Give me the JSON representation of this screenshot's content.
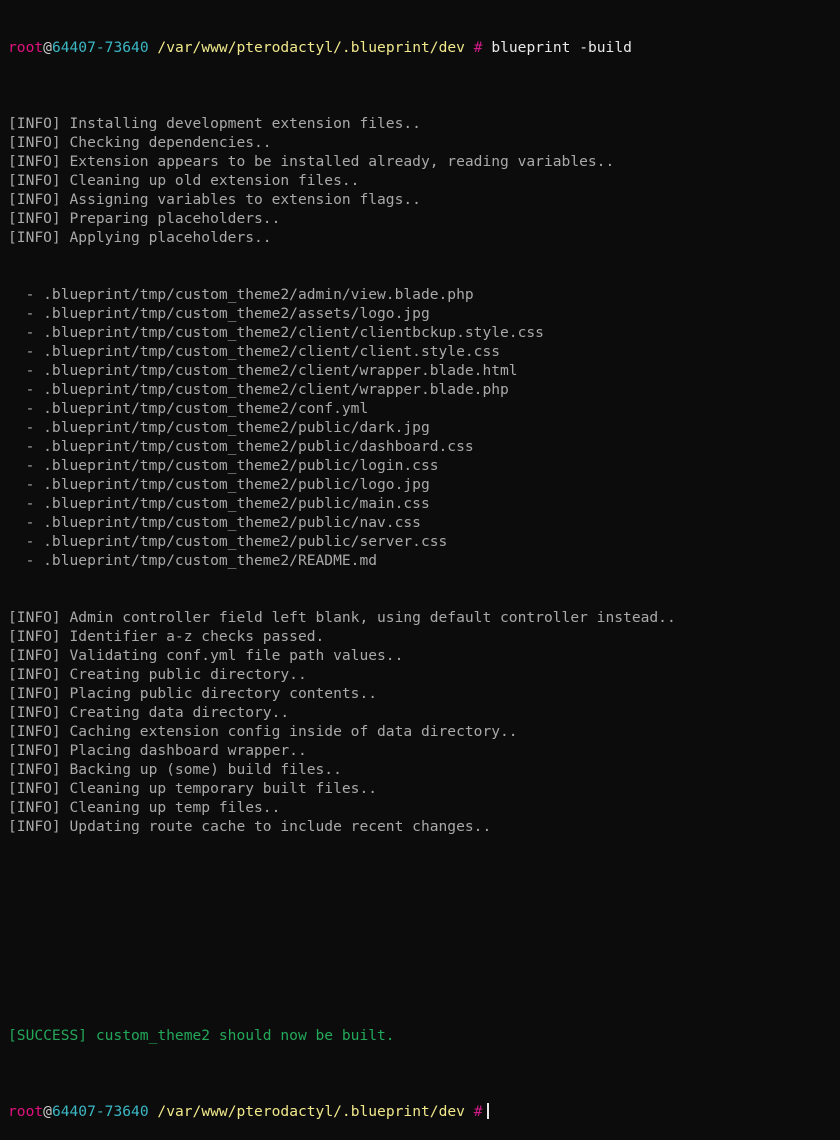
{
  "prompt": {
    "user": "root",
    "at": "@",
    "host": "64407-73640",
    "path": "/var/www/pterodactyl/.blueprint/dev",
    "symbol": "#"
  },
  "command": "blueprint -build",
  "lines_before_files": [
    "[INFO] Installing development extension files..",
    "[INFO] Checking dependencies..",
    "[INFO] Extension appears to be installed already, reading variables..",
    "[INFO] Cleaning up old extension files..",
    "[INFO] Assigning variables to extension flags..",
    "[INFO] Preparing placeholders..",
    "[INFO] Applying placeholders.."
  ],
  "files": [
    "  - .blueprint/tmp/custom_theme2/admin/view.blade.php",
    "  - .blueprint/tmp/custom_theme2/assets/logo.jpg",
    "  - .blueprint/tmp/custom_theme2/client/clientbckup.style.css",
    "  - .blueprint/tmp/custom_theme2/client/client.style.css",
    "  - .blueprint/tmp/custom_theme2/client/wrapper.blade.html",
    "  - .blueprint/tmp/custom_theme2/client/wrapper.blade.php",
    "  - .blueprint/tmp/custom_theme2/conf.yml",
    "  - .blueprint/tmp/custom_theme2/public/dark.jpg",
    "  - .blueprint/tmp/custom_theme2/public/dashboard.css",
    "  - .blueprint/tmp/custom_theme2/public/login.css",
    "  - .blueprint/tmp/custom_theme2/public/logo.jpg",
    "  - .blueprint/tmp/custom_theme2/public/main.css",
    "  - .blueprint/tmp/custom_theme2/public/nav.css",
    "  - .blueprint/tmp/custom_theme2/public/server.css",
    "  - .blueprint/tmp/custom_theme2/README.md"
  ],
  "lines_after_files": [
    "[INFO] Admin controller field left blank, using default controller instead..",
    "[INFO] Identifier a-z checks passed.",
    "[INFO] Validating conf.yml file path values..",
    "[INFO] Creating public directory..",
    "[INFO] Placing public directory contents..",
    "[INFO] Creating data directory..",
    "[INFO] Caching extension config inside of data directory..",
    "[INFO] Placing dashboard wrapper..",
    "[INFO] Backing up (some) build files..",
    "[INFO] Cleaning up temporary built files..",
    "[INFO] Cleaning up temp files..",
    "[INFO] Updating route cache to include recent changes.."
  ],
  "success": "[SUCCESS] custom_theme2 should now be built.",
  "colors": {
    "background": "#0c0c0c",
    "user": "#e0127f",
    "host": "#3cb7c4",
    "path": "#f0e88a",
    "text": "#a9a9a9",
    "success": "#23a85a"
  }
}
